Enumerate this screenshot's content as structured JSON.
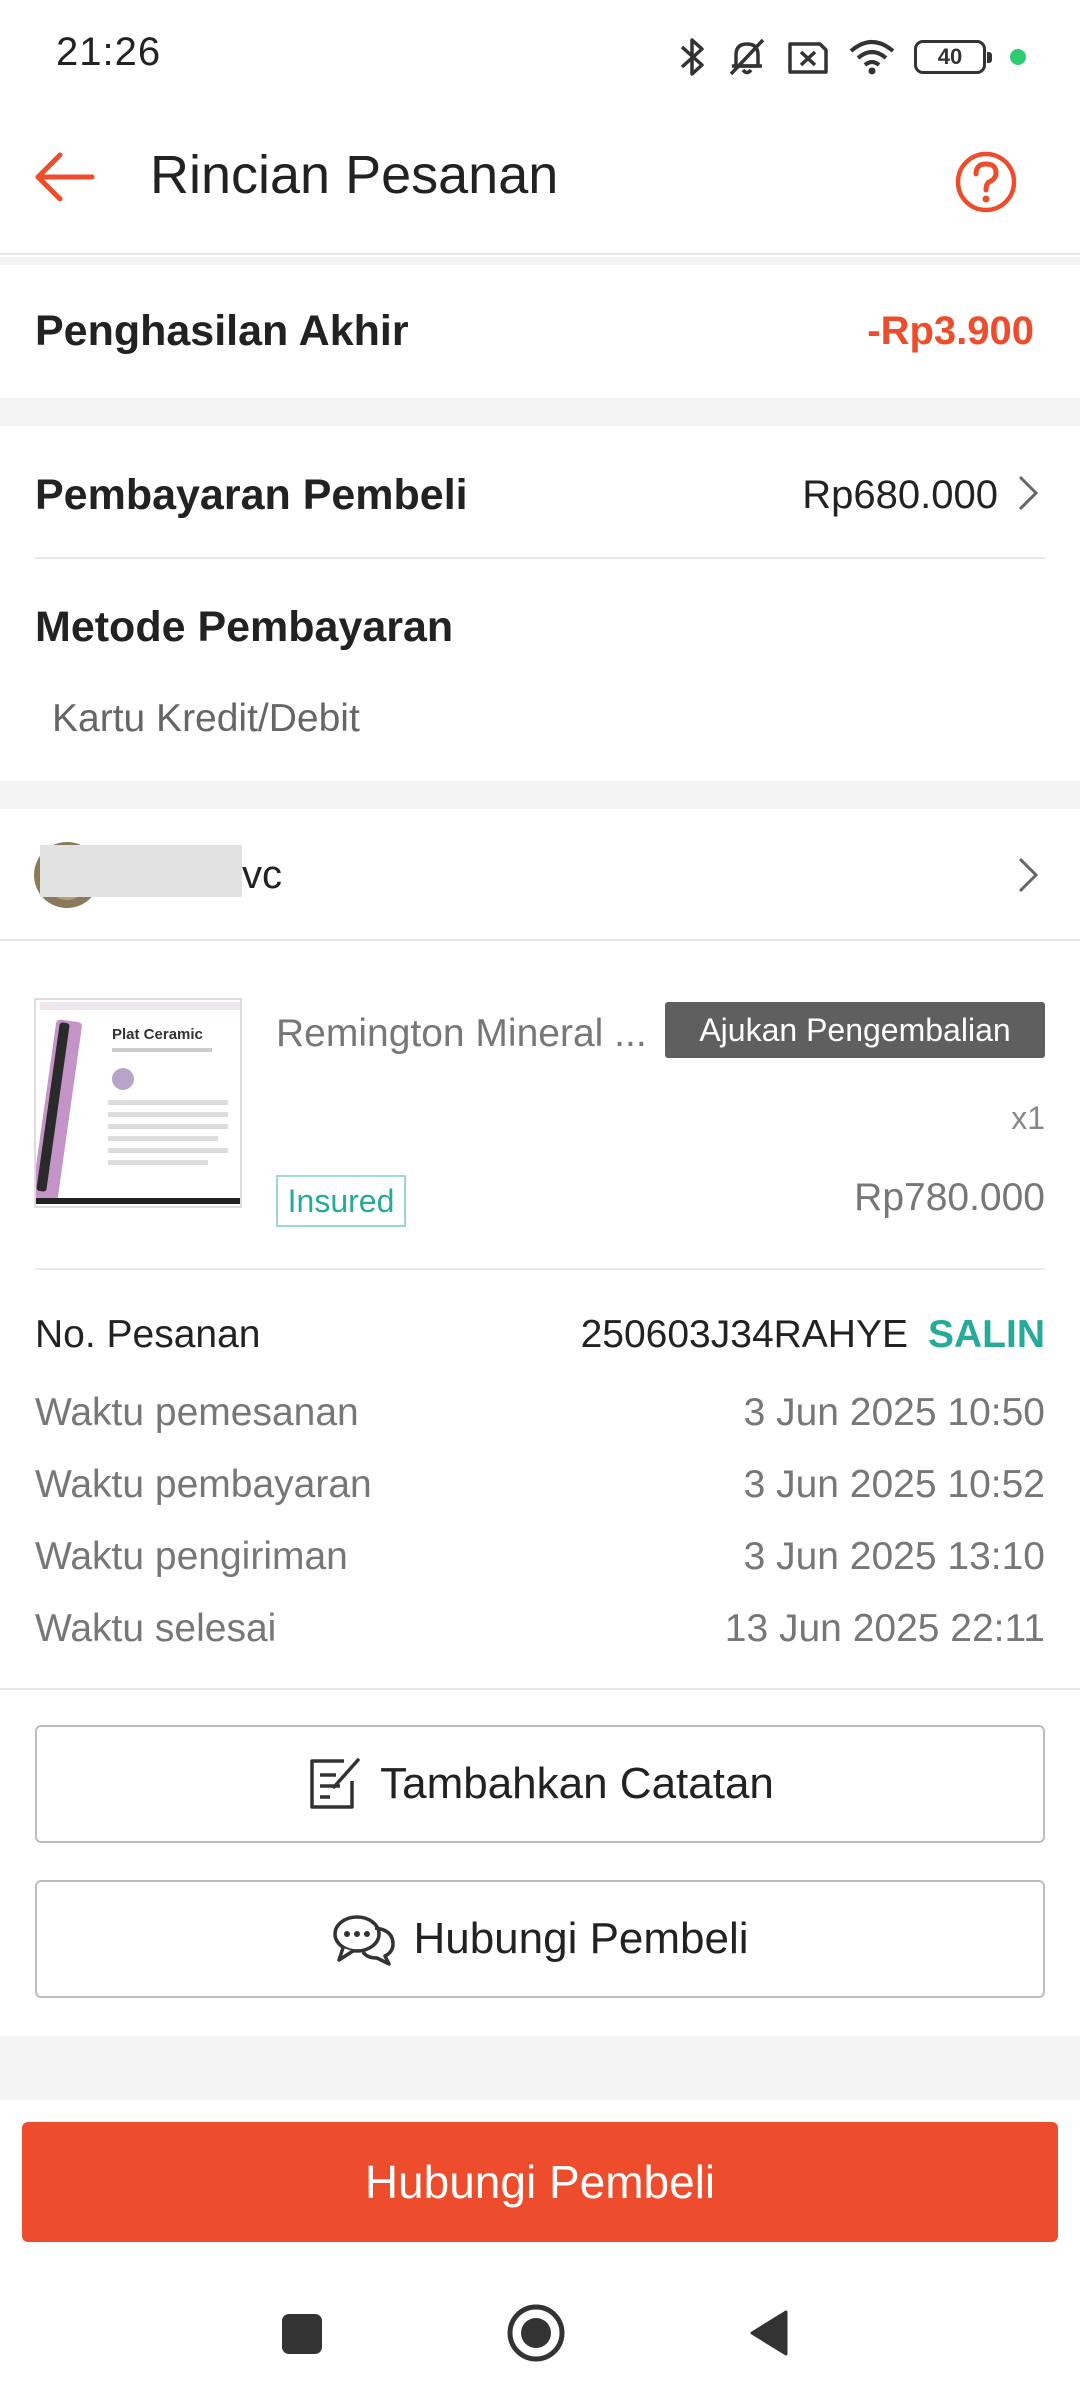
{
  "status_bar": {
    "time": "21:26",
    "battery": "40",
    "icons": [
      "bluetooth-icon",
      "bell-off-icon",
      "sim-off-icon",
      "wifi-icon",
      "battery-icon"
    ]
  },
  "header": {
    "title": "Rincian Pesanan",
    "back_icon": "arrow-left-icon",
    "help_icon": "help-circle-icon"
  },
  "income": {
    "label": "Penghasilan Akhir",
    "value": "-Rp3.900",
    "value_color": "#ee4d2d"
  },
  "payment": {
    "buyer_payment_label": "Pembayaran Pembeli",
    "buyer_payment_value": "Rp680.000",
    "method_label": "Metode Pembayaran",
    "method_value": "Kartu Kredit/Debit"
  },
  "buyer": {
    "name_suffix": "vc"
  },
  "product": {
    "name": "Remington Mineral ...",
    "return_button": "Ajukan Pengembalian",
    "quantity": "x1",
    "insured_badge": "Insured",
    "price": "Rp780.000",
    "thumb_text": "Plat Ceramic"
  },
  "order_info": {
    "order_no_label": "No. Pesanan",
    "order_no": "250603J34RAHYE",
    "copy_label": "SALIN",
    "rows": [
      {
        "label": "Waktu pemesanan",
        "value": "3 Jun 2025 10:50"
      },
      {
        "label": "Waktu pembayaran",
        "value": "3 Jun 2025 10:52"
      },
      {
        "label": "Waktu pengiriman",
        "value": "3 Jun 2025 13:10"
      },
      {
        "label": "Waktu selesai",
        "value": "13 Jun 2025 22:11"
      }
    ]
  },
  "actions": {
    "add_note": "Tambahkan Catatan",
    "contact_buyer": "Hubungi Pembeli",
    "primary_contact": "Hubungi Pembeli"
  },
  "colors": {
    "accent": "#ee4d2d",
    "teal": "#26aa99",
    "badge_bg": "#5f5f5f"
  }
}
